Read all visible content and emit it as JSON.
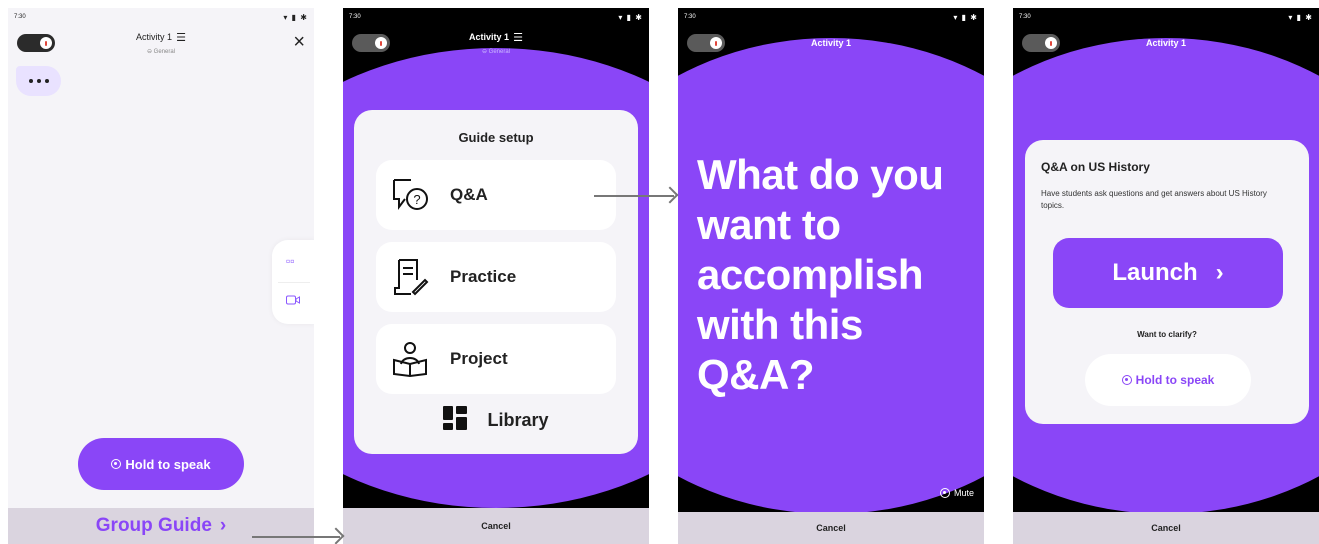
{
  "status": {
    "time": "7:30",
    "icons": "▾ ▮ ✱"
  },
  "screen1": {
    "title": "Activity 1",
    "subtitle": "⊖ General",
    "hold_to_speak": "Hold to speak",
    "bottom_label": "Group Guide",
    "tools": [
      "grid-icon",
      "video-icon"
    ]
  },
  "screen2": {
    "title": "Activity 1",
    "subtitle": "⊖ General",
    "card_heading": "Guide setup",
    "options": [
      {
        "label": "Q&A",
        "icon": "chat-question-icon"
      },
      {
        "label": "Practice",
        "icon": "document-pen-icon"
      },
      {
        "label": "Project",
        "icon": "person-book-icon"
      }
    ],
    "library_label": "Library",
    "cancel": "Cancel"
  },
  "screen3": {
    "title": "Activity 1",
    "question": "What do you want to accomplish with this Q&A?",
    "mute": "Mute",
    "cancel": "Cancel"
  },
  "screen4": {
    "title": "Activity 1",
    "card_title": "Q&A on US History",
    "card_desc": "Have students ask questions and get answers about US History topics.",
    "launch": "Launch",
    "clarify": "Want to clarify?",
    "hold_to_speak": "Hold to speak",
    "cancel": "Cancel"
  },
  "colors": {
    "accent": "#8a46f7",
    "card": "#f5f4f8",
    "bottom_bar": "#dad4df"
  }
}
